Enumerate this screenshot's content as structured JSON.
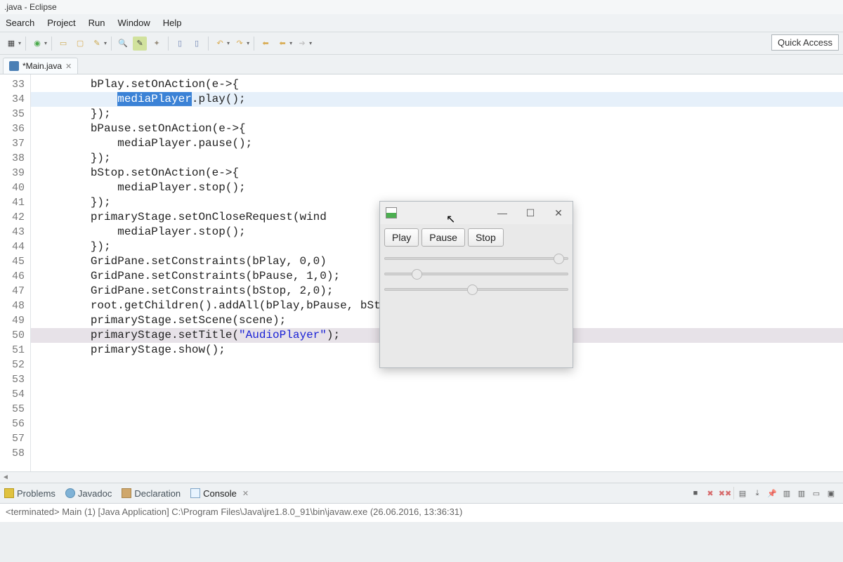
{
  "window": {
    "title": ".java - Eclipse"
  },
  "menu": {
    "items": [
      "Search",
      "Project",
      "Run",
      "Window",
      "Help"
    ]
  },
  "quick_access": "Quick Access",
  "editor": {
    "tab_label": "*Main.java",
    "selected_text": "mediaPlayer",
    "lines": [
      {
        "num": 33,
        "indent": "",
        "text": ""
      },
      {
        "num": 34,
        "indent": "        ",
        "text": "bPlay.setOnAction(e->{"
      },
      {
        "num": 35,
        "indent": "            ",
        "text_before_sel": "",
        "sel": "mediaPlayer",
        "text_after_sel": ".play();"
      },
      {
        "num": 36,
        "indent": "        ",
        "text": "});"
      },
      {
        "num": 37,
        "indent": "",
        "text": ""
      },
      {
        "num": 38,
        "indent": "        ",
        "text": "bPause.setOnAction(e->{"
      },
      {
        "num": 39,
        "indent": "            ",
        "text": "mediaPlayer.pause();"
      },
      {
        "num": 40,
        "indent": "        ",
        "text": "});"
      },
      {
        "num": 41,
        "indent": "",
        "text": ""
      },
      {
        "num": 42,
        "indent": "        ",
        "text": "bStop.setOnAction(e->{"
      },
      {
        "num": 43,
        "indent": "            ",
        "text": "mediaPlayer.stop();"
      },
      {
        "num": 44,
        "indent": "        ",
        "text": "});"
      },
      {
        "num": 45,
        "indent": "",
        "text": ""
      },
      {
        "num": 46,
        "indent": "        ",
        "text": "primaryStage.setOnCloseRequest(wind"
      },
      {
        "num": 47,
        "indent": "            ",
        "text": "mediaPlayer.stop();"
      },
      {
        "num": 48,
        "indent": "        ",
        "text": "});"
      },
      {
        "num": 49,
        "indent": "",
        "text": ""
      },
      {
        "num": 50,
        "indent": "        ",
        "text": "GridPane.setConstraints(bPlay, 0,0)"
      },
      {
        "num": 51,
        "indent": "        ",
        "text": "GridPane.setConstraints(bPause, 1,0);"
      },
      {
        "num": 52,
        "indent": "        ",
        "text": "GridPane.setConstraints(bStop, 2,0);"
      },
      {
        "num": 53,
        "indent": "",
        "text": ""
      },
      {
        "num": 54,
        "indent": "        ",
        "text": "root.getChildren().addAll(bPlay,bPause, bStop);"
      },
      {
        "num": 55,
        "indent": "",
        "text": ""
      },
      {
        "num": 56,
        "indent": "        ",
        "text": "primaryStage.setScene(scene);"
      },
      {
        "num": 57,
        "indent": "        ",
        "text_before_str": "primaryStage.setTitle(",
        "str": "\"AudioPlayer\"",
        "text_after_str": ");"
      },
      {
        "num": 58,
        "indent": "        ",
        "text": "primaryStage.show();"
      }
    ]
  },
  "bottom": {
    "tabs": {
      "problems": "Problems",
      "javadoc": "Javadoc",
      "declaration": "Declaration",
      "console": "Console"
    },
    "console_line": "<terminated> Main (1) [Java Application] C:\\Program Files\\Java\\jre1.8.0_91\\bin\\javaw.exe (26.06.2016, 13:36:31)"
  },
  "fx": {
    "buttons": {
      "play": "Play",
      "pause": "Pause",
      "stop": "Stop"
    },
    "sliders": [
      95,
      18,
      48
    ]
  }
}
